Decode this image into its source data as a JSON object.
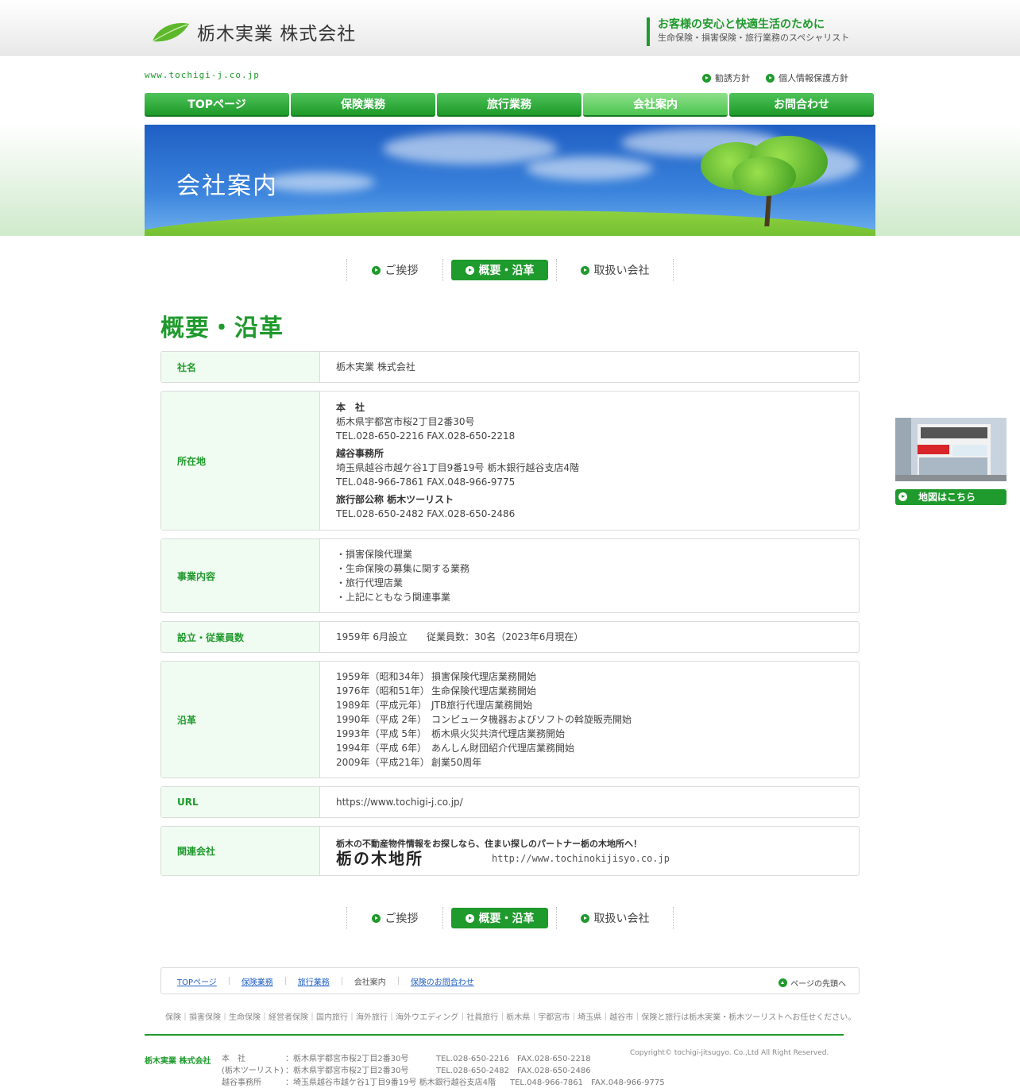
{
  "header": {
    "company_name": "栃木実業 株式会社",
    "tagline_main": "お客様の安心と快適生活のために",
    "tagline_sub": "生命保険・損害保険・旅行業務のスペシャリスト",
    "site_url": "www.tochigi-j.co.jp",
    "links": [
      "勧誘方針",
      "個人情報保護方針"
    ]
  },
  "nav": {
    "items": [
      "TOPページ",
      "保険業務",
      "旅行業務",
      "会社案内",
      "お問合わせ"
    ],
    "active": "会社案内"
  },
  "banner": {
    "title": "会社案内"
  },
  "subnav": {
    "items": [
      "ご挨拶",
      "概要・沿革",
      "取扱い会社"
    ],
    "active": "概要・沿革"
  },
  "page_heading": "概要・沿革",
  "table": {
    "company": {
      "label": "社名",
      "value": "栃木実業 株式会社"
    },
    "location": {
      "label": "所在地",
      "offices": [
        {
          "title": "本　社",
          "address": "栃木県宇都宮市桜2丁目2番30号",
          "tel": "TEL.028-650-2216 FAX.028-650-2218"
        },
        {
          "title": "越谷事務所",
          "address": "埼玉県越谷市越ケ谷1丁目9番19号 栃木銀行越谷支店4階",
          "tel": "TEL.048-966-7861 FAX.048-966-9775"
        },
        {
          "title": "旅行部公称 栃木ツーリスト",
          "address": "",
          "tel": "TEL.028-650-2482 FAX.028-650-2486"
        }
      ],
      "map_button": "地図はこちら"
    },
    "business": {
      "label": "事業内容",
      "items": [
        "・損害保険代理業",
        "・生命保険の募集に関する業務",
        "・旅行代理店業",
        "・上記にともなう関連事業"
      ]
    },
    "founding": {
      "label": "設立・従業員数",
      "value": "1959年 6月設立　　従業員数：30名（2023年6月現在）"
    },
    "history": {
      "label": "沿革",
      "items": [
        {
          "year": "1959年（昭和34年）",
          "event": "損害保険代理店業務開始"
        },
        {
          "year": "1976年（昭和51年）",
          "event": "生命保険代理店業務開始"
        },
        {
          "year": "1989年（平成元年）",
          "event": "JTB旅行代理店業務開始"
        },
        {
          "year": "1990年（平成 2年）",
          "event": "コンピュータ機器およびソフトの斡旋販売開始"
        },
        {
          "year": "1993年（平成 5年）",
          "event": "栃木県火災共済代理店業務開始"
        },
        {
          "year": "1994年（平成 6年）",
          "event": "あんしん財団紹介代理店業務開始"
        },
        {
          "year": "2009年（平成21年）",
          "event": "創業50周年"
        }
      ]
    },
    "url": {
      "label": "URL",
      "value": "https://www.tochigi-j.co.jp/"
    },
    "related": {
      "label": "関連会社",
      "catch": "栃木の不動産物件情報をお探しなら、住まい探しのパートナー栃の木地所へ！",
      "name": "栃の木地所",
      "url": "http://www.tochinokijisyo.co.jp"
    }
  },
  "footer": {
    "nav": [
      "TOPページ",
      "保険業務",
      "旅行業務",
      "会社案内",
      "保険のお問合わせ"
    ],
    "current": "会社案内",
    "pagetop": "ページの先頭へ",
    "keywords": "保険｜損害保険｜生命保険｜経営者保険｜国内旅行｜海外旅行｜海外ウエディング｜社員旅行｜栃木県｜宇都宮市｜埼玉県｜越谷市｜保険と旅行は栃木実業・栃木ツーリストへお任せください。",
    "company": "栃木実業 株式会社",
    "offices": [
      {
        "name": "本　社",
        "address": "：栃木県宇都宮市桜2丁目2番30号",
        "tel": "TEL.028-650-2216　FAX.028-650-2218"
      },
      {
        "name": "(栃木ツーリスト)",
        "address": "：栃木県宇都宮市桜2丁目2番30号",
        "tel": "TEL.028-650-2482　FAX.028-650-2486"
      },
      {
        "name": "越谷事務所",
        "address": "：埼玉県越谷市越ケ谷1丁目9番19号 栃木銀行越谷支店4階",
        "tel": "TEL.048-966-7861　FAX.048-966-9775"
      }
    ],
    "copyright": "Copyright© tochigi-jitsugyo. Co.,Ltd All Right Reserved."
  },
  "colors": {
    "brand_green": "#1f9a2c",
    "active_nav": "#6cd46a",
    "table_header_bg": "#f0fbf1",
    "link_blue": "#1f5fc4"
  },
  "icons": [
    "leaf-logo-icon",
    "arrow-circle-icon",
    "arrow-up-circle-icon"
  ]
}
